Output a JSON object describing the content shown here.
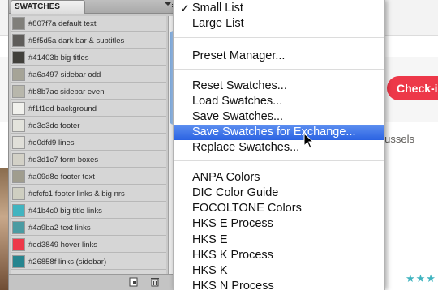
{
  "background": {
    "checkin_label": "Check-in",
    "location_text": "ar Brussels",
    "stars": "★★★"
  },
  "panel": {
    "title": "SWATCHES",
    "swatches": [
      {
        "color": "#807f7a",
        "label": "#807f7a default text"
      },
      {
        "color": "#5f5d5a",
        "label": "#5f5d5a dark bar & subtitles"
      },
      {
        "color": "#41403b",
        "label": "#41403b big titles"
      },
      {
        "color": "#a6a497",
        "label": "#a6a497 sidebar odd"
      },
      {
        "color": "#b8b7ac",
        "label": "#b8b7ac sidebar even"
      },
      {
        "color": "#f1f1ed",
        "label": "#f1f1ed background"
      },
      {
        "color": "#e3e3dc",
        "label": "#e3e3dc footer"
      },
      {
        "color": "#e0dfd9",
        "label": "#e0dfd9 lines"
      },
      {
        "color": "#d3d1c7",
        "label": "#d3d1c7 form boxes"
      },
      {
        "color": "#a09d8e",
        "label": "#a09d8e footer text"
      },
      {
        "color": "#cfcfc1",
        "label": "#cfcfc1  footer links & big nrs"
      },
      {
        "color": "#41b4c0",
        "label": "#41b4c0 big title links"
      },
      {
        "color": "#4a9ba2",
        "label": "#4a9ba2 text links"
      },
      {
        "color": "#ed3849",
        "label": "#ed3849 hover links"
      },
      {
        "color": "#26858f",
        "label": "#26858f links (sidebar)"
      }
    ]
  },
  "menu": {
    "items": [
      {
        "label": "Small List",
        "checked": true
      },
      {
        "label": "Large List"
      },
      {
        "label": "Preset Manager..."
      },
      {
        "label": "Reset Swatches..."
      },
      {
        "label": "Load Swatches..."
      },
      {
        "label": "Save Swatches..."
      },
      {
        "label": "Save Swatches for Exchange...",
        "highlighted": true
      },
      {
        "label": "Replace Swatches..."
      },
      {
        "label": "ANPA Colors"
      },
      {
        "label": "DIC Color Guide"
      },
      {
        "label": "FOCOLTONE Colors"
      },
      {
        "label": "HKS E Process"
      },
      {
        "label": "HKS E"
      },
      {
        "label": "HKS K Process"
      },
      {
        "label": "HKS K"
      },
      {
        "label": "HKS N Process"
      }
    ],
    "check_glyph": "✓"
  }
}
